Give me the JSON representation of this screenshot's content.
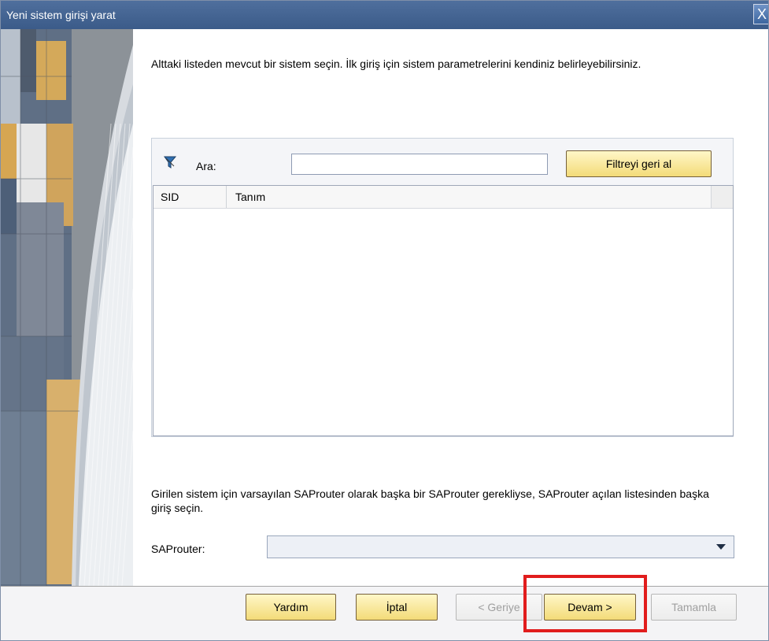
{
  "window": {
    "title": "Yeni sistem girişi yarat",
    "close_symbol": "X"
  },
  "main": {
    "prompt": "Alttaki listeden mevcut bir sistem seçin. İlk giriş için sistem parametrelerini kendiniz belirleyebilirsiniz.",
    "search_label": "Ara:",
    "search_value": "",
    "filter_button_label": "Filtreyi geri al",
    "table": {
      "columns": [
        "SID",
        "Tanım"
      ],
      "rows": []
    },
    "info": "Girilen sistem için varsayılan SAProuter olarak başka bir SAProuter gerekliyse, SAProuter açılan listesinden başka giriş seçin.",
    "router_label": "SAProuter:",
    "router_value": ""
  },
  "footer": {
    "help": "Yardım",
    "cancel": "İptal",
    "back": "< Geriye",
    "next": "Devam >",
    "finish": "Tamamla"
  },
  "colors": {
    "title_bar": "#4f6f9d",
    "button_fill": "#f3db78",
    "highlight": "#e11d1d"
  }
}
